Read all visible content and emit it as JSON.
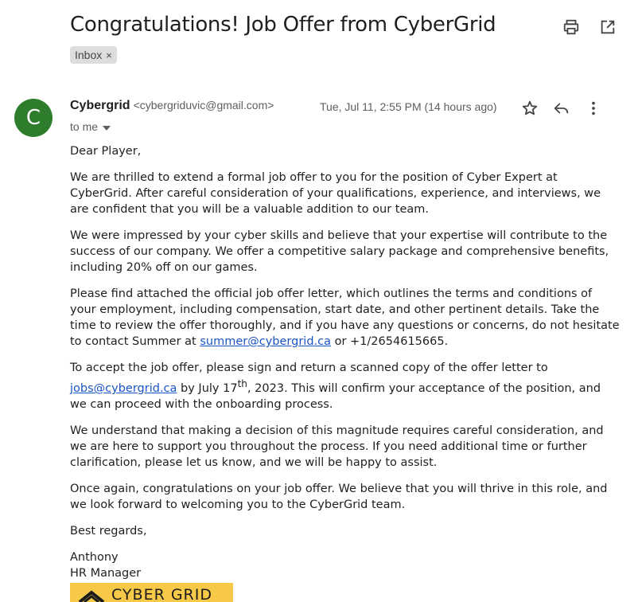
{
  "email": {
    "subject": "Congratulations! Job Offer from CyberGrid",
    "label": "Inbox",
    "label_remove": "×",
    "avatar_letter": "C",
    "sender_name": "Cybergrid",
    "sender_email": "<cybergriduvic@gmail.com>",
    "datetime": "Tue, Jul 11, 2:55 PM (14 hours ago)",
    "to_line": "to me",
    "body": {
      "greeting": "Dear Player,",
      "p1": "We are thrilled to extend a formal job offer to you for the position of Cyber Expert at CyberGrid. After careful consideration of your qualifications, experience, and interviews, we are confident that you will be a valuable addition to our team.",
      "p2": "We were impressed by your cyber skills and believe that your expertise will contribute to the success of our company. We offer a competitive salary package and comprehensive benefits, including 20% off on our games.",
      "p3_a": "Please find attached the official job offer letter, which outlines the terms and conditions of your employment, including compensation, start date, and other pertinent details. Take the time to review the offer thoroughly, and if you have any questions or concerns, do not hesitate to contact Summer at ",
      "p3_link": "summer@cybergrid.ca",
      "p3_b": " or +1/2654615665.",
      "p4_a": "To accept the job offer, please sign and return a scanned copy of the offer letter to ",
      "p4_link": "jobs@cybergrid.ca",
      "p4_b": " by July 17",
      "p4_sup": "th",
      "p4_c": ", 2023. This will confirm your acceptance of the position, and we can proceed with the onboarding process.",
      "p5": "We understand that making a decision of this magnitude requires careful consideration, and we are here to support you throughout the process. If you need additional time or further clarification, please let us know, and we will be happy to assist.",
      "p6": "Once again, congratulations on your job offer. We believe that you will thrive in this role, and we look forward to welcoming you to the CyberGrid team.",
      "closing": "Best regards,",
      "sign_name": "Anthony",
      "sign_title": "HR Manager"
    },
    "logo_text": "CYBER GRID"
  },
  "icons": {
    "print": "print-icon",
    "open_new": "open-in-new-window-icon",
    "star": "star-icon",
    "reply": "reply-icon",
    "more": "more-vertical-icon",
    "dropdown": "chevron-down-icon"
  },
  "colors": {
    "avatar_bg": "#2d7d2d",
    "link": "#1a55c4",
    "logo_bg": "#f7c948",
    "chip_bg": "#dddddd"
  }
}
